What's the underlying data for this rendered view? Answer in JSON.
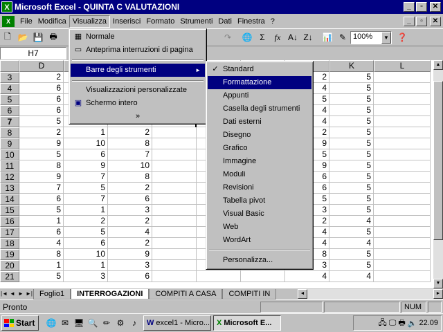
{
  "window": {
    "title": "Microsoft Excel - QUINTA C VALUTAZIONI",
    "app_icon": "X",
    "minimize": "_",
    "maximize": "▫",
    "close": "✕"
  },
  "menus": [
    "File",
    "Modifica",
    "Visualizza",
    "Inserisci",
    "Formato",
    "Strumenti",
    "Dati",
    "Finestra",
    "?"
  ],
  "toolbar": {
    "zoom": "100%"
  },
  "namebox": "H7",
  "columns": [
    "D",
    "E",
    "F",
    "G",
    "H",
    "I",
    "J",
    "K",
    "L"
  ],
  "rows": [
    {
      "n": "3",
      "d": "2",
      "e": "",
      "f": "",
      "j": "2",
      "k": "5"
    },
    {
      "n": "4",
      "d": "6",
      "e": "",
      "f": "",
      "j": "4",
      "k": "5"
    },
    {
      "n": "5",
      "d": "6",
      "e": "",
      "f": "",
      "j": "5",
      "k": "5"
    },
    {
      "n": "6",
      "d": "6",
      "e": "",
      "f": "",
      "j": "4",
      "k": "5"
    },
    {
      "n": "7",
      "d": "5",
      "e": "5",
      "f": "2",
      "j": "4",
      "k": "5"
    },
    {
      "n": "8",
      "d": "2",
      "e": "1",
      "f": "2",
      "j": "2",
      "k": "5"
    },
    {
      "n": "9",
      "d": "9",
      "e": "10",
      "f": "8",
      "j": "9",
      "k": "5"
    },
    {
      "n": "10",
      "d": "5",
      "e": "6",
      "f": "7",
      "j": "5",
      "k": "5"
    },
    {
      "n": "11",
      "d": "8",
      "e": "9",
      "f": "10",
      "j": "9",
      "k": "5"
    },
    {
      "n": "12",
      "d": "9",
      "e": "7",
      "f": "8",
      "j": "6",
      "k": "5"
    },
    {
      "n": "13",
      "d": "7",
      "e": "5",
      "f": "2",
      "j": "6",
      "k": "5"
    },
    {
      "n": "14",
      "d": "6",
      "e": "7",
      "f": "6",
      "j": "5",
      "k": "5"
    },
    {
      "n": "15",
      "d": "5",
      "e": "1",
      "f": "3",
      "j": "3",
      "k": "5"
    },
    {
      "n": "16",
      "d": "1",
      "e": "2",
      "f": "2",
      "j": "2",
      "k": "4"
    },
    {
      "n": "17",
      "d": "6",
      "e": "5",
      "f": "4",
      "j": "4",
      "k": "5"
    },
    {
      "n": "18",
      "d": "4",
      "e": "6",
      "f": "2",
      "j": "4",
      "k": "4"
    },
    {
      "n": "19",
      "d": "8",
      "e": "10",
      "f": "9",
      "j": "8",
      "k": "5"
    },
    {
      "n": "20",
      "d": "1",
      "e": "1",
      "f": "3",
      "j": "3",
      "k": "5"
    },
    {
      "n": "21",
      "d": "5",
      "e": "3",
      "f": "6",
      "j": "4",
      "k": "4"
    }
  ],
  "view_menu": {
    "items": [
      {
        "label": "Normale",
        "icon": "normal-view-icon"
      },
      {
        "label": "Anteprima interruzioni di pagina",
        "icon": "page-break-icon"
      },
      {
        "label": "Barre degli strumenti",
        "icon": "",
        "submenu": true
      },
      {
        "label": "Visualizzazioni personalizzate",
        "icon": ""
      },
      {
        "label": "Schermo intero",
        "icon": "full-screen-icon"
      }
    ],
    "expand": "»"
  },
  "toolbars_submenu": [
    {
      "label": "Standard",
      "checked": true
    },
    {
      "label": "Formattazione",
      "highlighted": true
    },
    {
      "label": "Appunti"
    },
    {
      "label": "Casella degli strumenti"
    },
    {
      "label": "Dati esterni"
    },
    {
      "label": "Disegno"
    },
    {
      "label": "Grafico"
    },
    {
      "label": "Immagine"
    },
    {
      "label": "Moduli"
    },
    {
      "label": "Revisioni"
    },
    {
      "label": "Tabella pivot"
    },
    {
      "label": "Visual Basic"
    },
    {
      "label": "Web"
    },
    {
      "label": "WordArt"
    },
    {
      "label": "Personalizza..."
    }
  ],
  "sheets": [
    "Foglio1",
    "INTERROGAZIONI",
    "COMPITI A CASA",
    "COMPITI IN"
  ],
  "status": {
    "text": "Pronto",
    "num": "NUM"
  },
  "taskbar": {
    "start": "Start",
    "tasks": [
      "excel1 - Micro...",
      "Microsoft E..."
    ],
    "clock": "22.09"
  }
}
